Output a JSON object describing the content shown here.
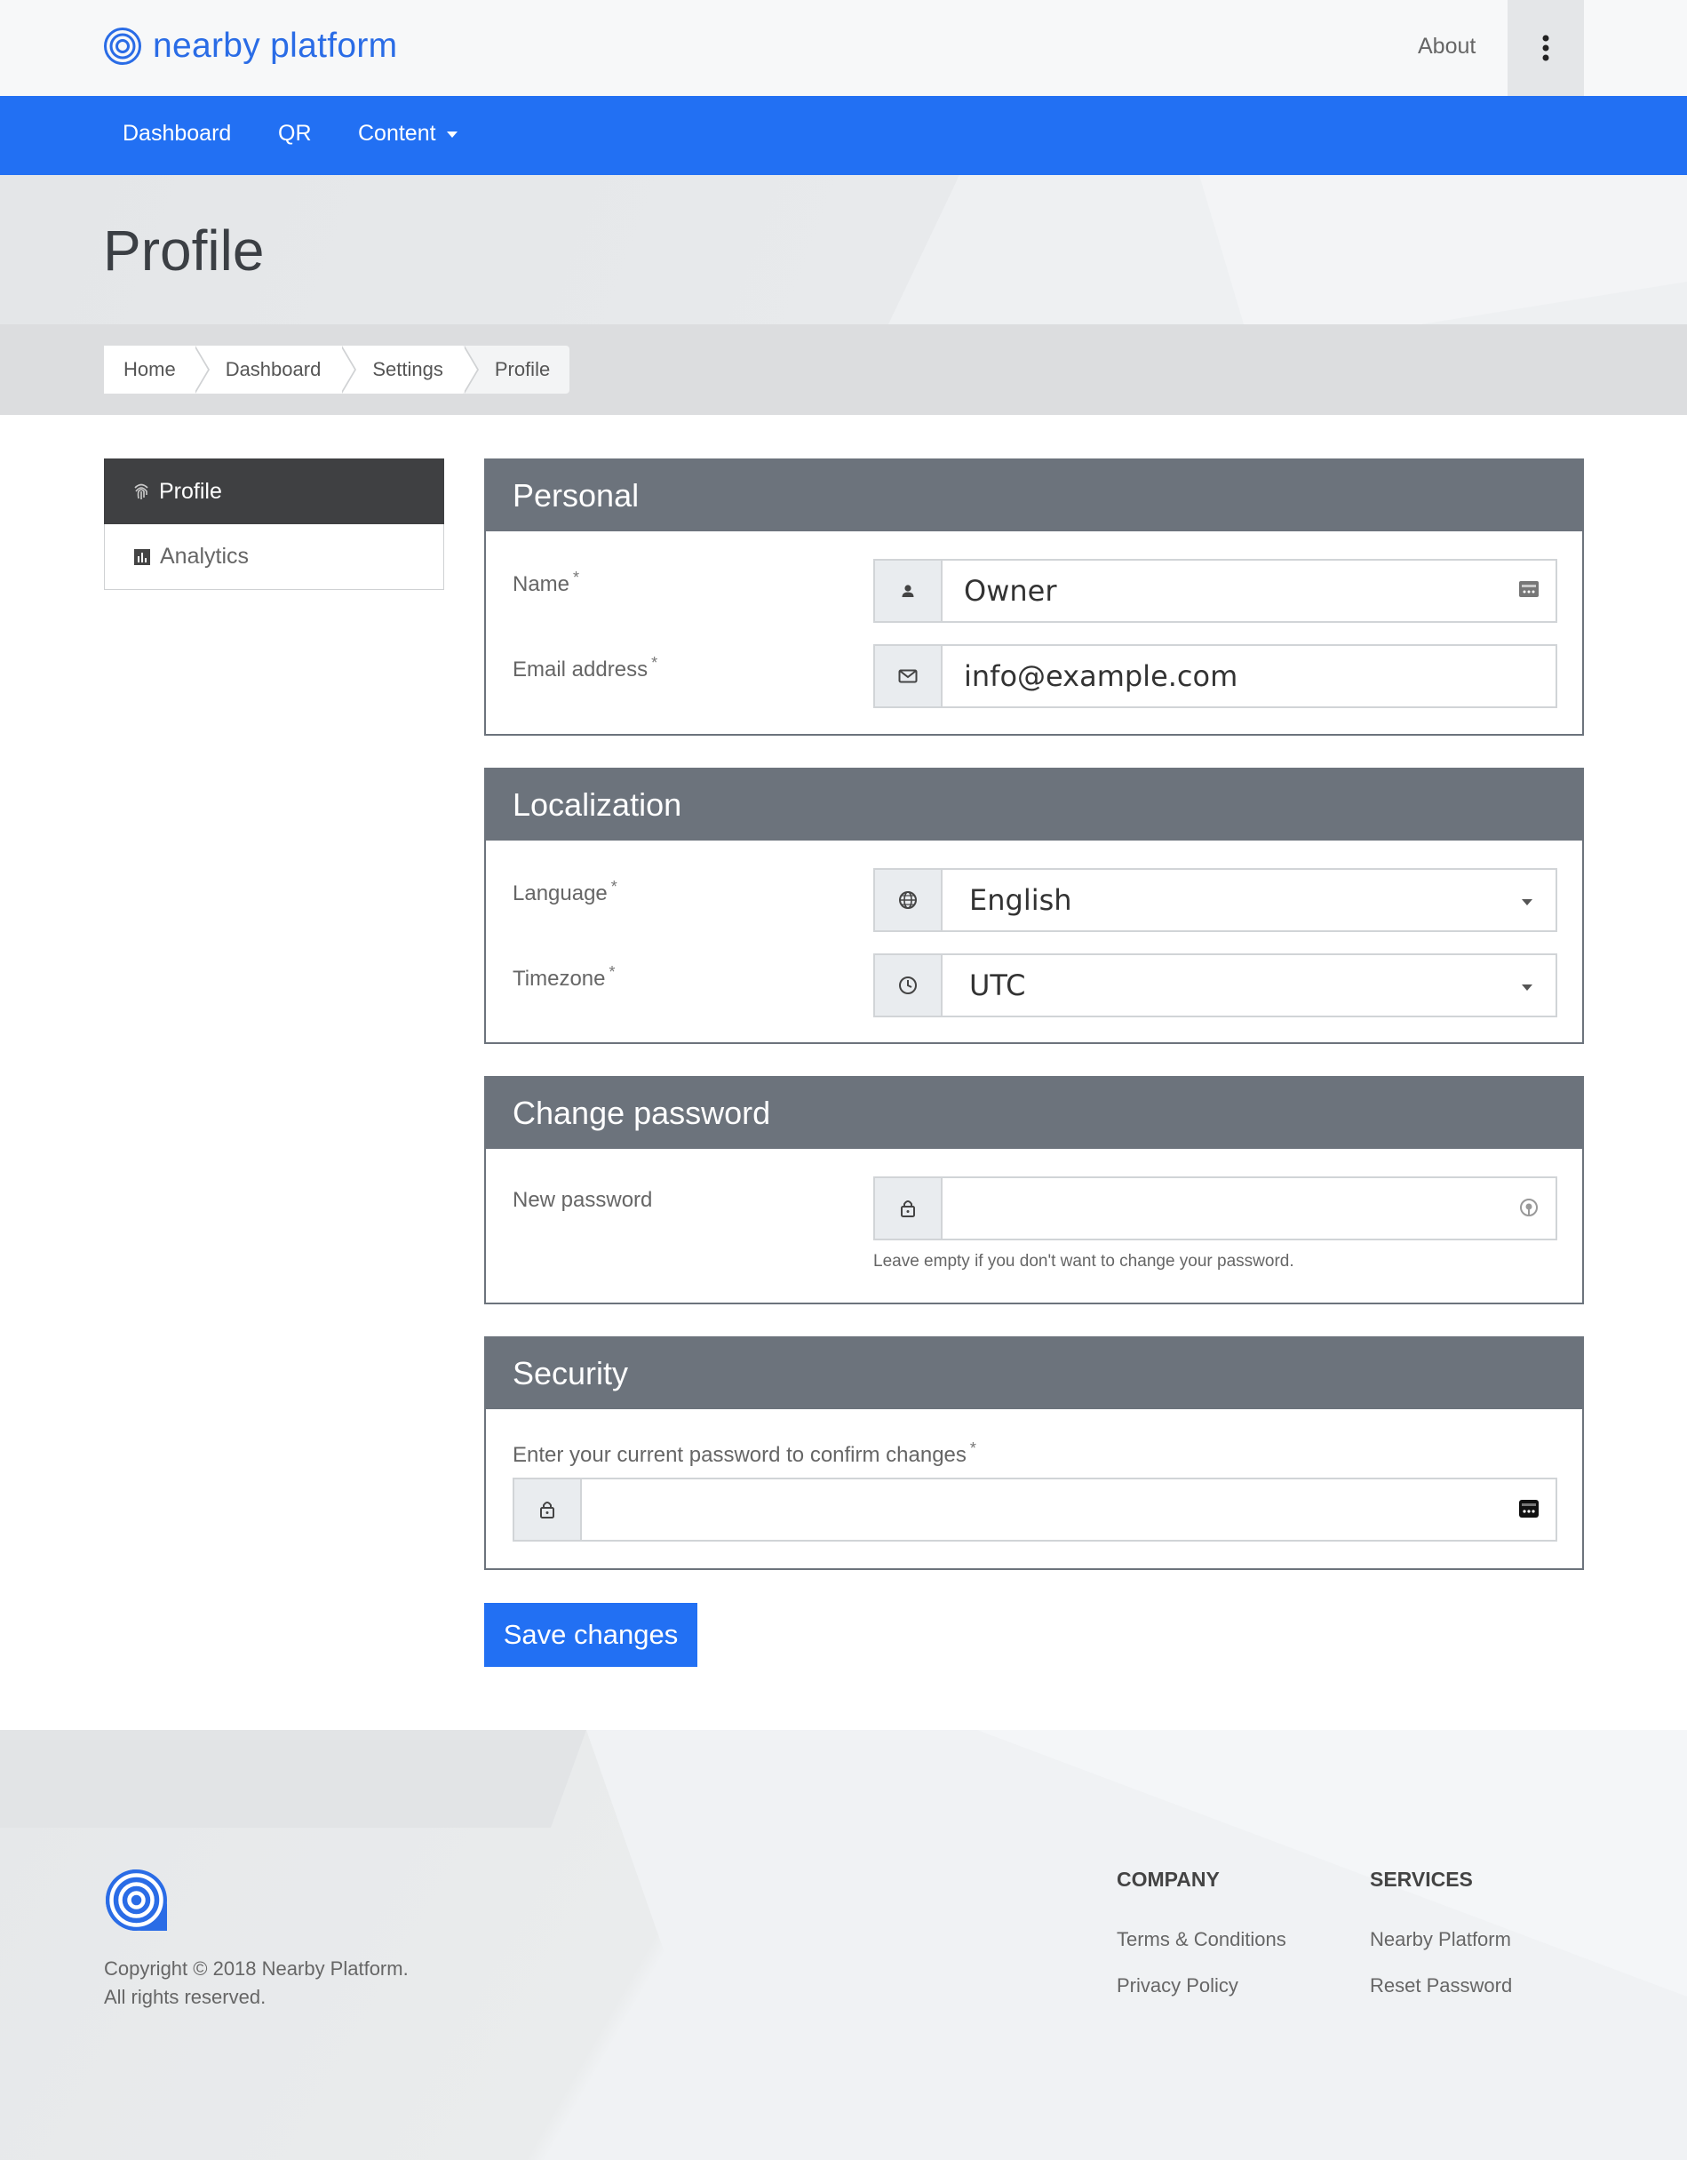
{
  "header": {
    "logo_text": "nearby platform",
    "about": "About",
    "menu_icon": "kebab-menu-icon"
  },
  "nav": {
    "items": [
      {
        "label": "Dashboard"
      },
      {
        "label": "QR"
      },
      {
        "label": "Content"
      }
    ]
  },
  "page": {
    "title": "Profile"
  },
  "breadcrumb": [
    "Home",
    "Dashboard",
    "Settings",
    "Profile"
  ],
  "sidebar": {
    "items": [
      {
        "label": "Profile",
        "icon": "fingerprint-icon",
        "active": true
      },
      {
        "label": "Analytics",
        "icon": "bar-chart-icon",
        "active": false
      }
    ]
  },
  "personal": {
    "title": "Personal",
    "name_label": "Name",
    "name_value": "Owner",
    "email_label": "Email address",
    "email_value": "info@example.com",
    "required_mark": "*"
  },
  "localization": {
    "title": "Localization",
    "language_label": "Language",
    "language_value": "English",
    "timezone_label": "Timezone",
    "timezone_value": "UTC"
  },
  "password": {
    "title": "Change password",
    "new_label": "New password",
    "new_value": "",
    "help": "Leave empty if you don't want to change your password."
  },
  "security": {
    "title": "Security",
    "confirm_label": "Enter your current password to confirm changes",
    "confirm_value": ""
  },
  "actions": {
    "save": "Save changes"
  },
  "footer": {
    "copyright_line1": "Copyright © 2018 Nearby Platform.",
    "copyright_line2": "All rights reserved.",
    "company": {
      "heading": "COMPANY",
      "links": [
        "Terms & Conditions",
        "Privacy Policy"
      ]
    },
    "services": {
      "heading": "SERVICES",
      "links": [
        "Nearby Platform",
        "Reset Password"
      ]
    }
  },
  "colors": {
    "brand": "#2270f3",
    "panel_header": "#6c737c",
    "sidebar_active": "#3f4042"
  }
}
